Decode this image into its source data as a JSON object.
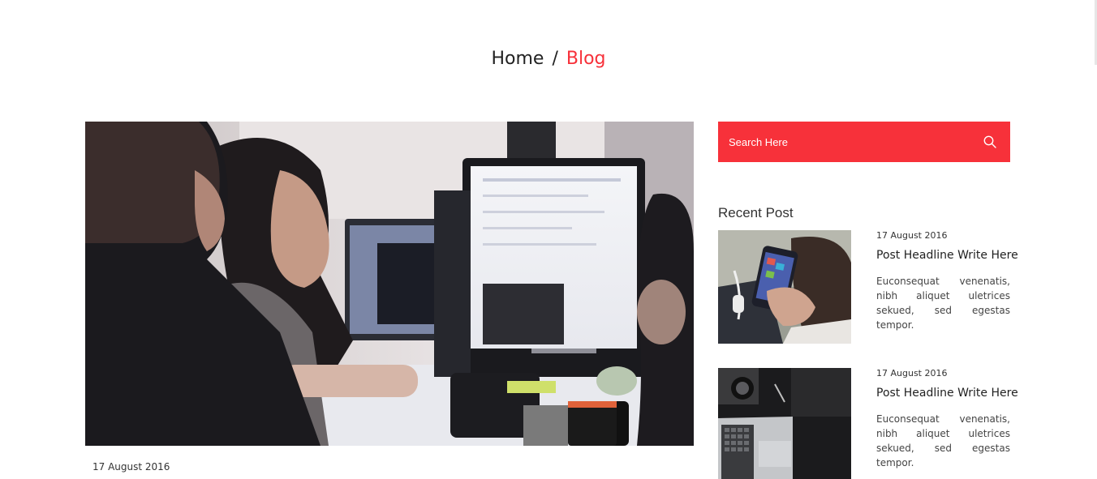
{
  "breadcrumb": {
    "home": "Home",
    "separator": "/",
    "current": "Blog"
  },
  "main_post": {
    "date": "17 August 2016"
  },
  "search": {
    "placeholder": "Search Here",
    "icon": "search-icon"
  },
  "sidebar": {
    "recent_title": "Recent Post",
    "posts": [
      {
        "date": "17 August 2016",
        "headline": "Post Headline Write Here",
        "excerpt": "Euconsequat venenatis, nibh aliquet uletrices sekued, sed egestas tempor."
      },
      {
        "date": "17 August 2016",
        "headline": "Post Headline Write Here",
        "excerpt": "Euconsequat venenatis, nibh aliquet uletrices sekued, sed egestas tempor."
      }
    ]
  },
  "colors": {
    "accent": "#f7313a",
    "text": "#222222"
  }
}
